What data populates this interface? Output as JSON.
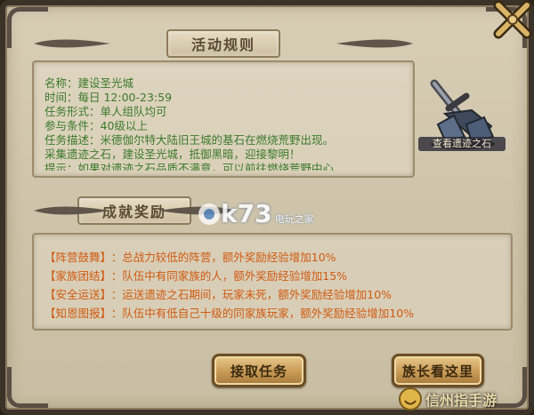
{
  "window": {
    "close_icon": "close-x-icon"
  },
  "rules": {
    "header": "活动规则",
    "lines": [
      "名称：建设圣光城",
      "时间：每日 12:00-23:59",
      "任务形式：单人组队均可",
      "参与条件：40级以上",
      "任务描述：米德伽尔特大陆旧王城的基石在燃烧荒野出现。",
      "采集遗迹之石，建设圣光城，抵御黑暗，迎接黎明！",
      "提示：如果对遗迹之石品质不满意，可以前往燃烧荒野中心"
    ]
  },
  "stone": {
    "label": "查看遗迹之石",
    "icon": "sword-stone-icon"
  },
  "rewards": {
    "header": "成就奖励",
    "items": [
      {
        "tag": "【阵营鼓舞】",
        "text": "：总战力较低的阵营，额外奖励经验增加10%"
      },
      {
        "tag": "【家族团结】",
        "text": "：队伍中有同家族的人，额外奖励经验增加15%"
      },
      {
        "tag": "【安全运送】",
        "text": "：运送遗迹之石期间，玩家未死，额外奖励经验增加10%"
      },
      {
        "tag": "【知恩图报】",
        "text": "：队伍中有低自己十级的同家族玩家，额外奖励经验增加10%"
      }
    ]
  },
  "buttons": {
    "accept": "接取任务",
    "leader": "族长看这里"
  },
  "watermarks": {
    "k73": "k73",
    "k73_sub": "电玩之家",
    "site": "信州指手游"
  }
}
